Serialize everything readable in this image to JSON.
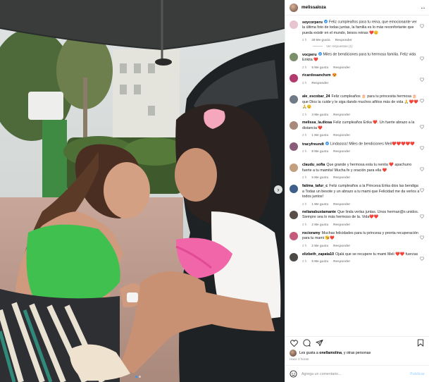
{
  "post": {
    "username": "melissaloza",
    "more_glyph": "···",
    "next_glyph": "›"
  },
  "comments": [
    {
      "user": "soycorperu",
      "verified": true,
      "text": "Feliz cumpleaños para tu reina, que emocionante ver la última foto de todas juntas, la familia es lo más reconfortante que pueda existir en el mundo, besos reinas ❤️😊",
      "time": "2 h",
      "likes": "28 Me gusta",
      "reply": "Responder",
      "replies": "Ver respuestas (1)",
      "avatar_color": "#e8c3d0"
    },
    {
      "user": "vocperu",
      "verified": true,
      "text": "Miles de bendiciones para tu hermosa familia. Feliz vida Erikita ❤️",
      "time": "2 h",
      "likes": "5 Me gusta",
      "reply": "Responder",
      "avatar_color": "#7b8f6a"
    },
    {
      "user": "ricardosanchzm",
      "verified": false,
      "text": "😍",
      "time": "2 h",
      "likes": "",
      "reply": "Responder",
      "avatar_color": "#b33a6c"
    },
    {
      "user": "ale_escobar_24",
      "verified": false,
      "text": "Feliz cumpleaños 🎂 para tu princesita hermosa 🎂 que Dios la cuide y le siga dando muchos añitos más de vida 🙏❤️❤️🙏😊",
      "time": "2 h",
      "likes": "3 Me gusta",
      "reply": "Responder",
      "avatar_color": "#6f7a86"
    },
    {
      "user": "melissa_la.diosa",
      "verified": false,
      "text": "Feliz cumpleaños Erika ❤️. Un fuerte abrazo a la distancia ❤️",
      "time": "2 h",
      "likes": "1 Me gusta",
      "reply": "Responder",
      "avatar_color": "#a88a7a"
    },
    {
      "user": "tracyfreundt",
      "verified": true,
      "text": "Lindassss! Miles de bendiciones Meli❤️❤️❤️❤️❤️",
      "time": "2 h",
      "likes": "8 Me gusta",
      "reply": "Responder",
      "avatar_color": "#8a5c7c"
    },
    {
      "user": "claudu_sofia",
      "verified": false,
      "text": "Que grande y hermosa esta tu nenita ❤️ apachurro fuerte a tu mamita! Mucha fe y oración para ella ❤️",
      "time": "2 h",
      "likes": "5 Me gusta",
      "reply": "Responder",
      "avatar_color": "#c2a07f"
    },
    {
      "user": "fatima_tafur_c",
      "verified": false,
      "text": "Feliz cumpleaños a la Princesa Erika dios las bendiga a Todas un besote y un abrazo a tu mami que Felicidad me da verlos a todos juntos!",
      "time": "2 h",
      "likes": "1 Me gusta",
      "reply": "Responder",
      "avatar_color": "#3f5f8a"
    },
    {
      "user": "nelianabustamante",
      "verified": false,
      "text": "Que linda verlas juntas. Unos herman@s unidos. Siempre sea lo más hermoso de la. Vida❤️❤️",
      "time": "2 h",
      "likes": "2 Me gusta",
      "reply": "Responder",
      "avatar_color": "#5a4e48"
    },
    {
      "user": "rocioramy",
      "verified": false,
      "text": "Muchas felicidades para tu princesa y pronta recuperación para tu mami 😘❤️",
      "time": "2 h",
      "likes": "2 Me gusta",
      "reply": "Responder",
      "avatar_color": "#c65a7b"
    },
    {
      "user": "elizbeth_zapata10",
      "verified": false,
      "text": "Ojalá que se recupere tu mami Meli ❤️❤️ fuerzas",
      "time": "2 h",
      "likes": "5 Me gusta",
      "reply": "Responder",
      "avatar_color": "#4d4944"
    }
  ],
  "footer": {
    "likes_prefix": "Les gusta a",
    "liker": "onellamolina",
    "likes_suffix": "y otras personas",
    "time_ago": "Hace 2 horas",
    "add_placeholder": "Agrega un comentario...",
    "post_label": "Publicar",
    "more_comments_glyph": "+"
  },
  "icons": {
    "like": "heart-icon",
    "comment": "comment-icon",
    "share": "send-icon",
    "save": "bookmark-icon",
    "emoji": "emoji-icon"
  },
  "colors": {
    "link_blue": "#3897f0",
    "muted": "#8e8e8e",
    "verified": "#3897f0",
    "post_disabled": "#b3dbff"
  }
}
